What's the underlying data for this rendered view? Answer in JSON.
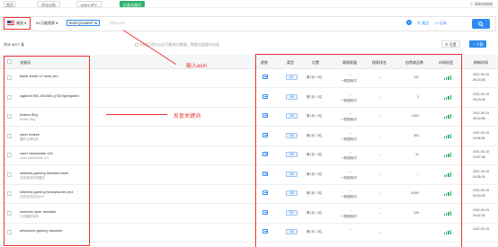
{
  "nav": {
    "tabs": [
      "首页",
      "评论分析",
      "ASIN SPY",
      "反查关键词"
    ],
    "active_tab": 3,
    "help_label": "帮助和指南"
  },
  "search": {
    "marketplace": "美国",
    "match_type": "ID/万能搜索",
    "asin_chip": "B09FQG9MRP",
    "placeholder": "添加ASIN",
    "group_label": "我品",
    "record_label": "记录"
  },
  "annotations": {
    "input_asin": "输入asin",
    "reverse_keywords": "反查关键词"
  },
  "toolbar": {
    "total_text": "共计 4577 条",
    "filter_hint": "时间已改为以后可能有点数量，数据也会缓冲出现",
    "settings_label": "设置",
    "download_label": "+ 下载"
  },
  "table": {
    "headers": {
      "keyword": "关键词",
      "trend": "趋势",
      "type": "类型",
      "position": "位置",
      "search_volume": "周搜索量",
      "search_rank": "搜索排名",
      "product_count": "自然商品数",
      "market_share": "市场机会",
      "updated": "刷新时间"
    },
    "rows": [
      {
        "kw": "black shark v2 razer pro",
        "kw_cn": "",
        "type": "AC",
        "pos": "第1页 / 9位",
        "vol": "--",
        "vol2": "一般搜索词",
        "rank": "--",
        "count": "122",
        "bars": [
          2,
          3,
          4,
          5
        ],
        "date": "2021-09-15",
        "time": "05:23:36"
      },
      {
        "kw": "logitech 981-000683 g733 lightspeed",
        "kw_cn": "",
        "type": "SB",
        "pos": "第1页 / 1位",
        "vol": "--",
        "vol2": "一般搜索词",
        "rank": "--",
        "count": "3",
        "bars": [
          2,
          3,
          4,
          5
        ],
        "date": "2021-09-15",
        "time": "05:23:35"
      },
      {
        "kw": "kraken 8bg",
        "kw_cn": "kraken 8bg",
        "type": "SB",
        "pos": "第1页 / 2位",
        "vol": "--",
        "vol2": "一般搜索词",
        "rank": "--",
        "count": "1,604",
        "bars": [
          2,
          3,
          4,
          5
        ],
        "date": "2021-09-15",
        "time": "05:16:56"
      },
      {
        "kw": "razer kraken",
        "kw_cn": "雷蛇北海巨妖",
        "type": "SB",
        "pos": "第1页 / 3位",
        "vol": "--",
        "vol2": "一般搜索词",
        "rank": "--",
        "count": "364",
        "bars": [
          2,
          3,
          4,
          5
        ],
        "date": "2021-09-15",
        "time": "04:58:56"
      },
      {
        "kw": "razer blackshark v2x",
        "kw_cn": "razer blackshark v2x",
        "type": "SB",
        "pos": "第1页 / 3位",
        "vol": "--",
        "vol2": "一般搜索词",
        "rank": "--",
        "count": "41",
        "bars": [
          2,
          3,
          4,
          5
        ],
        "date": "2021-09-15",
        "time": "04:57:38"
      },
      {
        "kw": "wireless gaming headset razer",
        "kw_cn": "无线游戏耳机雷蛇",
        "type": "SB",
        "pos": "第1页 / 3位",
        "vol": "--",
        "vol2": "一般搜索词",
        "rank": "--",
        "count": "--",
        "bars": [
          2,
          3,
          4,
          5
        ],
        "date": "2021-09-15",
        "time": "04:55:26"
      },
      {
        "kw": "wireless gaming headphones ps4",
        "kw_cn": "无线游戏耳机ps4",
        "type": "SB",
        "pos": "第1页 / 3位",
        "vol": "--",
        "vol2": "一般搜索词",
        "rank": "--",
        "count": "8,699",
        "bars": [
          2,
          3,
          4,
          5
        ],
        "date": "2021-09-15",
        "time": "04:53:26"
      },
      {
        "kw": "wireless razer headset",
        "kw_cn": "无线雷蛇耳机",
        "type": "SP",
        "pos": "第1页 / 3位",
        "vol": "--",
        "vol2": "一般搜索词",
        "rank": "--",
        "count": "326",
        "bars": [
          2,
          3,
          4,
          5
        ],
        "date": "2021-09-15",
        "time": "04:42:25"
      },
      {
        "kw": "advanced gaming headset",
        "kw_cn": "",
        "type": "SB",
        "pos": "第1页 / 3位",
        "vol": "--",
        "vol2": "",
        "rank": "--",
        "count": "",
        "bars": [
          2,
          3,
          4,
          5
        ],
        "date": "2021-09-15",
        "time": ""
      }
    ]
  },
  "colors": {
    "accent": "#2d8cf0",
    "active_tab": "#2db36d",
    "annotation": "#ee3333",
    "bars": "#2db36d"
  }
}
